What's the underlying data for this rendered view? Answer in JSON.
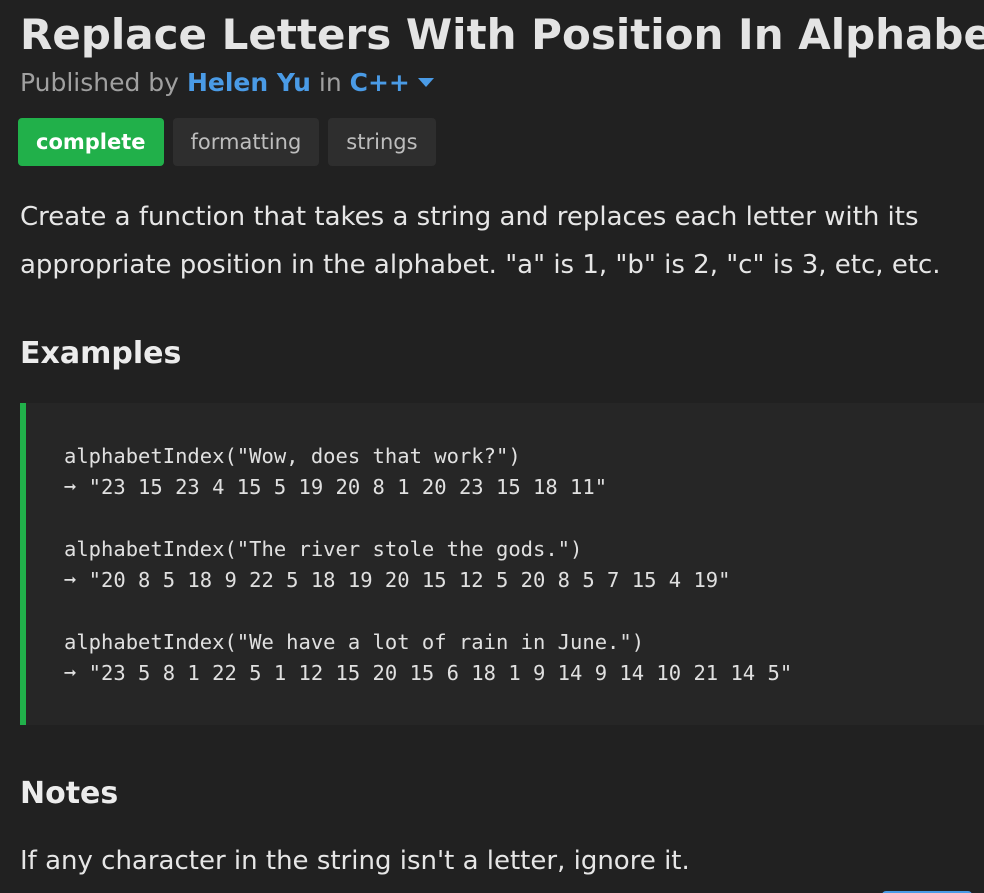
{
  "challenge": {
    "title": "Replace Letters With Position In Alphabet",
    "published_by_label": "Published by",
    "author": "Helen Yu",
    "in_label": "in",
    "language": "C++"
  },
  "tags": [
    {
      "label": "complete",
      "status": "complete"
    },
    {
      "label": "formatting"
    },
    {
      "label": "strings"
    }
  ],
  "description": "Create a function that takes a string and replaces each letter with its appropriate position in the alphabet. \"a\" is 1, \"b\" is 2, \"c\" is 3, etc, etc.",
  "examples_heading": "Examples",
  "examples": [
    {
      "call": "alphabetIndex(\"Wow, does that work?\")",
      "result": "➞ \"23 15 23 4 15 5 19 20 8 1 20 23 15 18 11\""
    },
    {
      "call": "alphabetIndex(\"The river stole the gods.\")",
      "result": "➞ \"20 8 5 18 9 22 5 18 19 20 15 12 5 20 8 5 7 15 4 19\""
    },
    {
      "call": "alphabetIndex(\"We have a lot of rain in June.\")",
      "result": "➞ \"23 5 8 1 22 5 1 12 15 20 15 6 18 1 9 14 9 14 10 21 14 5\""
    }
  ],
  "notes_heading": "Notes",
  "notes": "If any character in the string isn't a letter, ignore it.",
  "colors": {
    "background": "#212121",
    "accent_blue": "#4a9be6",
    "accent_green": "#21b04a",
    "tag_bg": "#2e2e2e"
  }
}
